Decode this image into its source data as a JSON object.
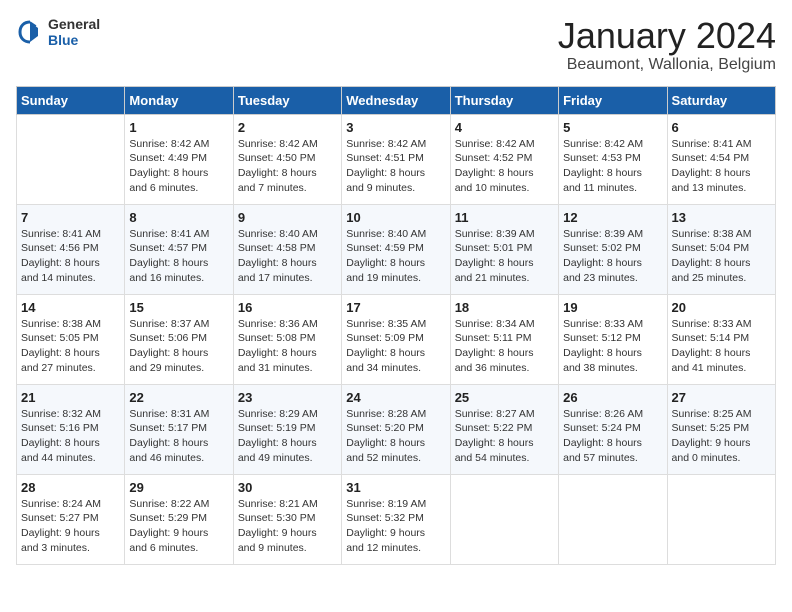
{
  "header": {
    "logo_general": "General",
    "logo_blue": "Blue",
    "month_title": "January 2024",
    "subtitle": "Beaumont, Wallonia, Belgium"
  },
  "days_of_week": [
    "Sunday",
    "Monday",
    "Tuesday",
    "Wednesday",
    "Thursday",
    "Friday",
    "Saturday"
  ],
  "weeks": [
    [
      {
        "day": "",
        "info": ""
      },
      {
        "day": "1",
        "info": "Sunrise: 8:42 AM\nSunset: 4:49 PM\nDaylight: 8 hours\nand 6 minutes."
      },
      {
        "day": "2",
        "info": "Sunrise: 8:42 AM\nSunset: 4:50 PM\nDaylight: 8 hours\nand 7 minutes."
      },
      {
        "day": "3",
        "info": "Sunrise: 8:42 AM\nSunset: 4:51 PM\nDaylight: 8 hours\nand 9 minutes."
      },
      {
        "day": "4",
        "info": "Sunrise: 8:42 AM\nSunset: 4:52 PM\nDaylight: 8 hours\nand 10 minutes."
      },
      {
        "day": "5",
        "info": "Sunrise: 8:42 AM\nSunset: 4:53 PM\nDaylight: 8 hours\nand 11 minutes."
      },
      {
        "day": "6",
        "info": "Sunrise: 8:41 AM\nSunset: 4:54 PM\nDaylight: 8 hours\nand 13 minutes."
      }
    ],
    [
      {
        "day": "7",
        "info": "Sunrise: 8:41 AM\nSunset: 4:56 PM\nDaylight: 8 hours\nand 14 minutes."
      },
      {
        "day": "8",
        "info": "Sunrise: 8:41 AM\nSunset: 4:57 PM\nDaylight: 8 hours\nand 16 minutes."
      },
      {
        "day": "9",
        "info": "Sunrise: 8:40 AM\nSunset: 4:58 PM\nDaylight: 8 hours\nand 17 minutes."
      },
      {
        "day": "10",
        "info": "Sunrise: 8:40 AM\nSunset: 4:59 PM\nDaylight: 8 hours\nand 19 minutes."
      },
      {
        "day": "11",
        "info": "Sunrise: 8:39 AM\nSunset: 5:01 PM\nDaylight: 8 hours\nand 21 minutes."
      },
      {
        "day": "12",
        "info": "Sunrise: 8:39 AM\nSunset: 5:02 PM\nDaylight: 8 hours\nand 23 minutes."
      },
      {
        "day": "13",
        "info": "Sunrise: 8:38 AM\nSunset: 5:04 PM\nDaylight: 8 hours\nand 25 minutes."
      }
    ],
    [
      {
        "day": "14",
        "info": "Sunrise: 8:38 AM\nSunset: 5:05 PM\nDaylight: 8 hours\nand 27 minutes."
      },
      {
        "day": "15",
        "info": "Sunrise: 8:37 AM\nSunset: 5:06 PM\nDaylight: 8 hours\nand 29 minutes."
      },
      {
        "day": "16",
        "info": "Sunrise: 8:36 AM\nSunset: 5:08 PM\nDaylight: 8 hours\nand 31 minutes."
      },
      {
        "day": "17",
        "info": "Sunrise: 8:35 AM\nSunset: 5:09 PM\nDaylight: 8 hours\nand 34 minutes."
      },
      {
        "day": "18",
        "info": "Sunrise: 8:34 AM\nSunset: 5:11 PM\nDaylight: 8 hours\nand 36 minutes."
      },
      {
        "day": "19",
        "info": "Sunrise: 8:33 AM\nSunset: 5:12 PM\nDaylight: 8 hours\nand 38 minutes."
      },
      {
        "day": "20",
        "info": "Sunrise: 8:33 AM\nSunset: 5:14 PM\nDaylight: 8 hours\nand 41 minutes."
      }
    ],
    [
      {
        "day": "21",
        "info": "Sunrise: 8:32 AM\nSunset: 5:16 PM\nDaylight: 8 hours\nand 44 minutes."
      },
      {
        "day": "22",
        "info": "Sunrise: 8:31 AM\nSunset: 5:17 PM\nDaylight: 8 hours\nand 46 minutes."
      },
      {
        "day": "23",
        "info": "Sunrise: 8:29 AM\nSunset: 5:19 PM\nDaylight: 8 hours\nand 49 minutes."
      },
      {
        "day": "24",
        "info": "Sunrise: 8:28 AM\nSunset: 5:20 PM\nDaylight: 8 hours\nand 52 minutes."
      },
      {
        "day": "25",
        "info": "Sunrise: 8:27 AM\nSunset: 5:22 PM\nDaylight: 8 hours\nand 54 minutes."
      },
      {
        "day": "26",
        "info": "Sunrise: 8:26 AM\nSunset: 5:24 PM\nDaylight: 8 hours\nand 57 minutes."
      },
      {
        "day": "27",
        "info": "Sunrise: 8:25 AM\nSunset: 5:25 PM\nDaylight: 9 hours\nand 0 minutes."
      }
    ],
    [
      {
        "day": "28",
        "info": "Sunrise: 8:24 AM\nSunset: 5:27 PM\nDaylight: 9 hours\nand 3 minutes."
      },
      {
        "day": "29",
        "info": "Sunrise: 8:22 AM\nSunset: 5:29 PM\nDaylight: 9 hours\nand 6 minutes."
      },
      {
        "day": "30",
        "info": "Sunrise: 8:21 AM\nSunset: 5:30 PM\nDaylight: 9 hours\nand 9 minutes."
      },
      {
        "day": "31",
        "info": "Sunrise: 8:19 AM\nSunset: 5:32 PM\nDaylight: 9 hours\nand 12 minutes."
      },
      {
        "day": "",
        "info": ""
      },
      {
        "day": "",
        "info": ""
      },
      {
        "day": "",
        "info": ""
      }
    ]
  ]
}
